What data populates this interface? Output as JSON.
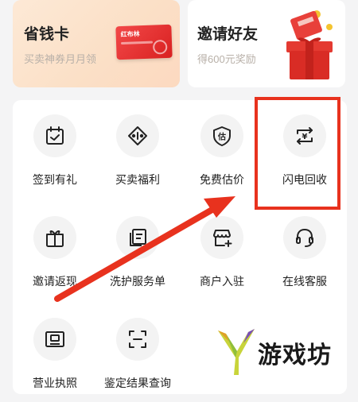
{
  "promos": [
    {
      "title": "省钱卡",
      "subtitle": "买卖神券月月领",
      "card_text": "红布林"
    },
    {
      "title": "邀请好友",
      "subtitle": "得600元奖励"
    }
  ],
  "grid": [
    {
      "label": "签到有礼",
      "icon": "calendar-check-icon"
    },
    {
      "label": "买卖福利",
      "icon": "tag-icon"
    },
    {
      "label": "免费估价",
      "icon": "shield-estimate-icon"
    },
    {
      "label": "闪电回收",
      "icon": "yen-exchange-icon"
    },
    {
      "label": "邀请返现",
      "icon": "gift-box-icon"
    },
    {
      "label": "洗护服务单",
      "icon": "documents-icon"
    },
    {
      "label": "商户入驻",
      "icon": "storefront-icon"
    },
    {
      "label": "在线客服",
      "icon": "headset-icon"
    },
    {
      "label": "营业执照",
      "icon": "license-icon"
    },
    {
      "label": "鉴定结果查询",
      "icon": "scan-icon"
    }
  ],
  "watermark": {
    "text": "游戏坊"
  },
  "colors": {
    "highlight": "#e8321e",
    "text": "#222222",
    "subtext": "#b8b0a8"
  }
}
